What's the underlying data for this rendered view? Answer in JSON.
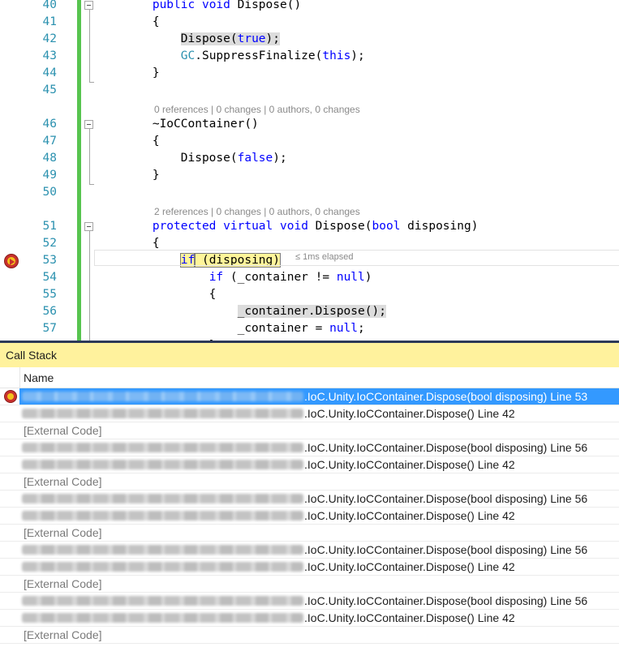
{
  "editor": {
    "lines": [
      {
        "num": "40",
        "code": [
          {
            "t": "        "
          },
          {
            "t": "public",
            "c": "kw"
          },
          {
            "t": " "
          },
          {
            "t": "void",
            "c": "kw"
          },
          {
            "t": " Dispose()"
          }
        ]
      },
      {
        "num": "41",
        "code": [
          {
            "t": "        {"
          }
        ]
      },
      {
        "num": "42",
        "code": [
          {
            "t": "            "
          },
          {
            "t": "Dispose(",
            "c": "hlg"
          },
          {
            "t": "true",
            "c": "kw hlg"
          },
          {
            "t": ");",
            "c": "hlg"
          }
        ]
      },
      {
        "num": "43",
        "code": [
          {
            "t": "            "
          },
          {
            "t": "GC",
            "c": "type"
          },
          {
            "t": ".SuppressFinalize("
          },
          {
            "t": "this",
            "c": "kw"
          },
          {
            "t": ");"
          }
        ]
      },
      {
        "num": "44",
        "code": [
          {
            "t": "        }"
          }
        ]
      },
      {
        "num": "45",
        "code": []
      },
      {
        "num": "46",
        "code": [
          {
            "t": "        ~IoCContainer()"
          }
        ]
      },
      {
        "num": "47",
        "code": [
          {
            "t": "        {"
          }
        ]
      },
      {
        "num": "48",
        "code": [
          {
            "t": "            Dispose("
          },
          {
            "t": "false",
            "c": "kw"
          },
          {
            "t": ");"
          }
        ]
      },
      {
        "num": "49",
        "code": [
          {
            "t": "        }"
          }
        ]
      },
      {
        "num": "50",
        "code": []
      },
      {
        "num": "51",
        "code": [
          {
            "t": "        "
          },
          {
            "t": "protected",
            "c": "kw"
          },
          {
            "t": " "
          },
          {
            "t": "virtual",
            "c": "kw"
          },
          {
            "t": " "
          },
          {
            "t": "void",
            "c": "kw"
          },
          {
            "t": " Dispose("
          },
          {
            "t": "bool",
            "c": "kw"
          },
          {
            "t": " disposing)"
          }
        ]
      },
      {
        "num": "52",
        "code": [
          {
            "t": "        {"
          }
        ]
      },
      {
        "num": "53",
        "code": [
          {
            "t": "            "
          },
          {
            "t": "if",
            "c": "kw hly"
          },
          {
            "t": " (disposing)",
            "c": "hly"
          }
        ]
      },
      {
        "num": "54",
        "code": [
          {
            "t": "                "
          },
          {
            "t": "if",
            "c": "kw"
          },
          {
            "t": " (_container != "
          },
          {
            "t": "null",
            "c": "kw"
          },
          {
            "t": ")"
          }
        ]
      },
      {
        "num": "55",
        "code": [
          {
            "t": "                {"
          }
        ]
      },
      {
        "num": "56",
        "code": [
          {
            "t": "                    "
          },
          {
            "t": "_container.Dispose();",
            "c": "hlg"
          }
        ]
      },
      {
        "num": "57",
        "code": [
          {
            "t": "                    _container = "
          },
          {
            "t": "null",
            "c": "kw"
          },
          {
            "t": ";"
          }
        ]
      },
      {
        "num": "",
        "code": [
          {
            "t": "                }"
          }
        ]
      }
    ],
    "codelens": [
      {
        "before_line": "46",
        "text": "0 references | 0 changes | 0 authors, 0 changes"
      },
      {
        "before_line": "51",
        "text": "2 references | 0 changes | 0 authors, 0 changes"
      }
    ],
    "perf_tip": "≤ 1ms elapsed",
    "current_line": "53"
  },
  "callstack": {
    "title": "Call Stack",
    "column_name": "Name",
    "rows": [
      {
        "type": "frame",
        "text": ".IoC.Unity.IoCContainer.Dispose(bool disposing) Line 53",
        "selected": true,
        "current": true
      },
      {
        "type": "frame",
        "text": ".IoC.Unity.IoCContainer.Dispose() Line 42"
      },
      {
        "type": "external",
        "text": "[External Code]"
      },
      {
        "type": "frame",
        "text": ".IoC.Unity.IoCContainer.Dispose(bool disposing) Line 56"
      },
      {
        "type": "frame",
        "text": ".IoC.Unity.IoCContainer.Dispose() Line 42"
      },
      {
        "type": "external",
        "text": "[External Code]"
      },
      {
        "type": "frame",
        "text": ".IoC.Unity.IoCContainer.Dispose(bool disposing) Line 56"
      },
      {
        "type": "frame",
        "text": ".IoC.Unity.IoCContainer.Dispose() Line 42"
      },
      {
        "type": "external",
        "text": "[External Code]"
      },
      {
        "type": "frame",
        "text": ".IoC.Unity.IoCContainer.Dispose(bool disposing) Line 56"
      },
      {
        "type": "frame",
        "text": ".IoC.Unity.IoCContainer.Dispose() Line 42"
      },
      {
        "type": "external",
        "text": "[External Code]"
      },
      {
        "type": "frame",
        "text": ".IoC.Unity.IoCContainer.Dispose(bool disposing) Line 56"
      },
      {
        "type": "frame",
        "text": ".IoC.Unity.IoCContainer.Dispose() Line 42"
      },
      {
        "type": "external",
        "text": "[External Code]"
      }
    ]
  },
  "colors": {
    "keyword": "#0000ff",
    "type": "#2b91af",
    "change_bar": "#57c44f",
    "selection": "#3399ff",
    "title_bar": "#fff29d"
  }
}
